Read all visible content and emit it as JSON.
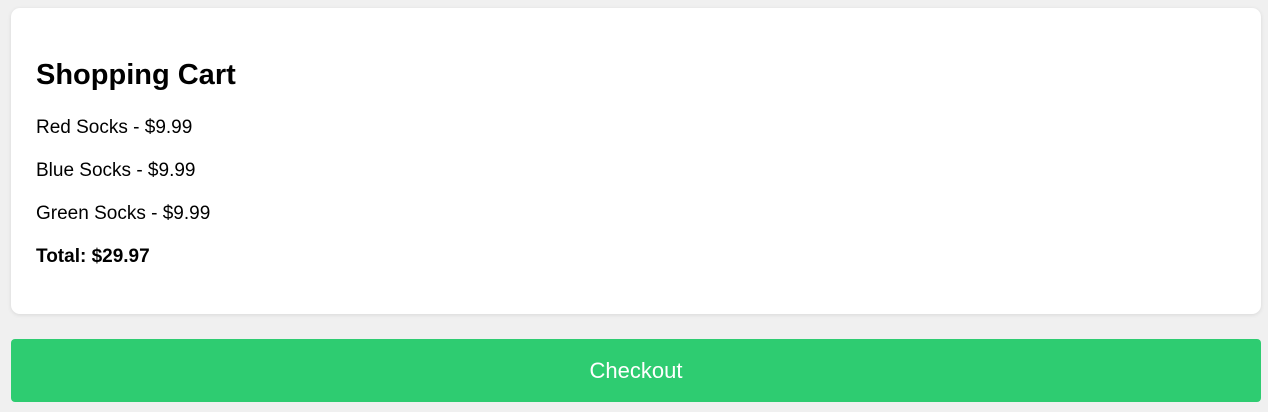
{
  "cart": {
    "title": "Shopping Cart",
    "items": [
      {
        "label": "Red Socks - $9.99"
      },
      {
        "label": "Blue Socks - $9.99"
      },
      {
        "label": "Green Socks - $9.99"
      }
    ],
    "total_label": "Total: $29.97"
  },
  "checkout": {
    "label": "Checkout",
    "color": "#2ecc71"
  },
  "colors": {
    "page_background": "#f0f0f0",
    "card_background": "#ffffff"
  }
}
